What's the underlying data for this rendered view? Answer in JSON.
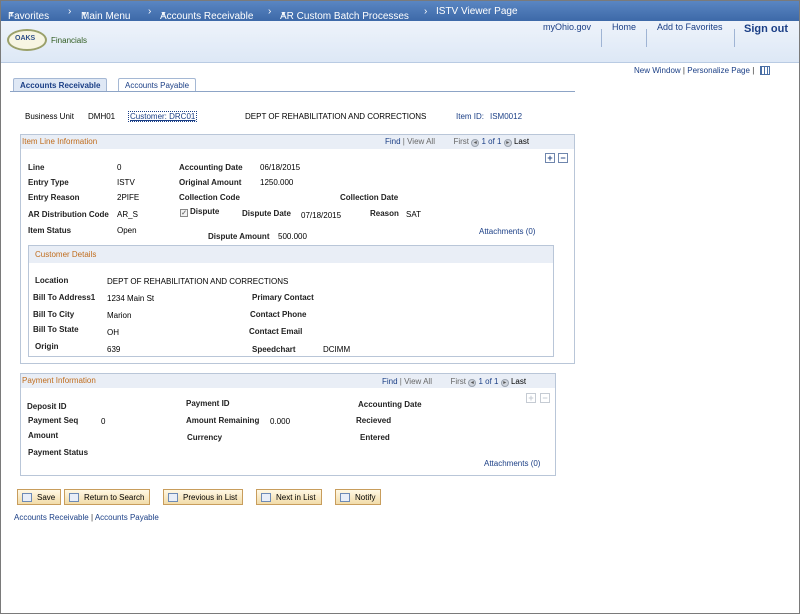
{
  "topnav": {
    "favorites": "Favorites",
    "main_menu": "Main Menu",
    "accounts_receivable": "Accounts Receivable",
    "custom_batch": "AR Custom Batch Processes",
    "current_page": "ISTV Viewer Page",
    "arrow": "▼",
    "chev": "›"
  },
  "header": {
    "logo_text": "OAKS",
    "logo_sub": "Financials",
    "myohio": "myOhio.gov",
    "home": "Home",
    "add_favorites": "Add to Favorites",
    "sign_out": "Sign out"
  },
  "page_links": {
    "new_window": "New Window",
    "sep": "|",
    "personalize": "Personalize Page",
    "sep2": "|"
  },
  "tabs": {
    "active": "Accounts Receivable",
    "inactive": "Accounts Payable"
  },
  "summary": {
    "bu_label": "Business Unit",
    "bu_value": "DMH01",
    "customer_link": "Customer: DRC01",
    "customer_name": "DEPT OF REHABILITATION AND CORRECTIONS",
    "item_id_label": "Item ID:",
    "item_id_value": "ISM0012"
  },
  "item_line": {
    "title": "Item Line Information",
    "find": "Find",
    "sep": "|",
    "view_all": "View All",
    "first": "First",
    "range": "1 of 1",
    "last": "Last",
    "prev": "◂",
    "next": "▸",
    "plus": "+",
    "minus": "−",
    "line_label": "Line",
    "line_value": "0",
    "acct_date_label": "Accounting Date",
    "acct_date_value": "06/18/2015",
    "entry_type_label": "Entry Type",
    "entry_type_value": "ISTV",
    "orig_amt_label": "Original Amount",
    "orig_amt_value": "1250.000",
    "entry_reason_label": "Entry Reason",
    "entry_reason_value": "2PIFE",
    "coll_code_label": "Collection Code",
    "coll_date_label": "Collection Date",
    "ar_dist_label": "AR Distribution Code",
    "ar_dist_value": "AR_S",
    "dispute_label": "Dispute",
    "check": "✓",
    "dispute_date_label": "Dispute Date",
    "dispute_date_value": "07/18/2015",
    "reason_label": "Reason",
    "reason_value": "SAT",
    "item_status_label": "Item Status",
    "item_status_value": "Open",
    "dispute_amt_label": "Dispute Amount",
    "dispute_amt_value": "500.000",
    "attachments": "Attachments (0)"
  },
  "customer_details": {
    "title": "Customer Details",
    "location_label": "Location",
    "location_value": "DEPT OF REHABILITATION AND CORRECTIONS",
    "bill_addr_label": "Bill To Address1",
    "bill_addr_value": "1234 Main St",
    "primary_contact_label": "Primary Contact",
    "bill_city_label": "Bill To City",
    "bill_city_value": "Marion",
    "contact_phone_label": "Contact Phone",
    "bill_state_label": "Bill To State",
    "bill_state_value": "OH",
    "contact_email_label": "Contact Email",
    "origin_label": "Origin",
    "origin_value": "639",
    "speedchart_label": "Speedchart",
    "speedchart_value": "DCIMM"
  },
  "payment": {
    "title": "Payment Information",
    "find": "Find",
    "sep": "|",
    "view_all": "View All",
    "first": "First",
    "range": "1 of 1",
    "last": "Last",
    "prev": "◂",
    "next": "▸",
    "plus": "+",
    "minus": "−",
    "deposit_id_label": "Deposit ID",
    "payment_id_label": "Payment ID",
    "acct_date_label": "Accounting Date",
    "pay_seq_label": "Payment Seq",
    "pay_seq_value": "0",
    "amt_remaining_label": "Amount Remaining",
    "amt_remaining_value": "0.000",
    "received_label": "Recieved",
    "amount_label": "Amount",
    "currency_label": "Currency",
    "entered_label": "Entered",
    "status_label": "Payment Status",
    "attachments": "Attachments (0)"
  },
  "buttons": {
    "save": "Save",
    "return_search": "Return to Search",
    "previous": "Previous in List",
    "next": "Next in List",
    "notify": "Notify"
  },
  "footer": {
    "ar": "Accounts Receivable",
    "sep": "|",
    "ap": "Accounts Payable"
  }
}
